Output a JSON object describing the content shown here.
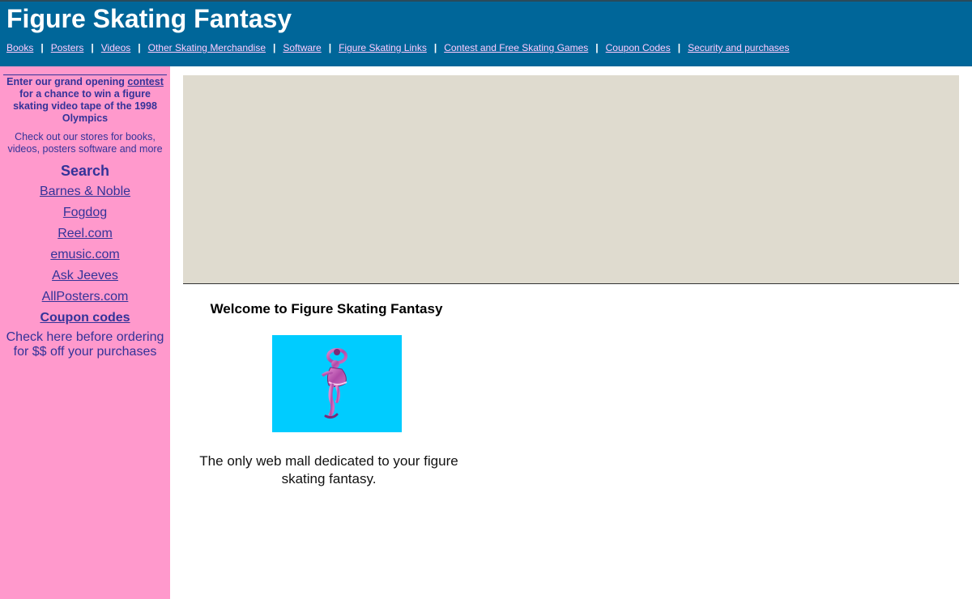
{
  "header": {
    "title": "Figure Skating Fantasy",
    "nav": [
      {
        "label": "Books"
      },
      {
        "label": "Posters"
      },
      {
        "label": "Videos"
      },
      {
        "label": "Other Skating Merchandise"
      },
      {
        "label": "Software"
      },
      {
        "label": "Figure Skating Links"
      },
      {
        "label": "Contest and Free Skating Games"
      },
      {
        "label": "Coupon Codes"
      },
      {
        "label": "Security and purchases"
      }
    ],
    "separator": "|"
  },
  "sidebar": {
    "promo_prefix": "Enter our grand opening ",
    "promo_link": "contest",
    "promo_suffix": " for a chance to win a figure skating video tape of the 1998 Olympics",
    "stores_note": "Check out our stores for books, videos, posters software and more",
    "search_heading": "Search",
    "search_links": [
      {
        "label": "Barnes & Noble"
      },
      {
        "label": "Fogdog"
      },
      {
        "label": "Reel.com"
      },
      {
        "label": "emusic.com"
      },
      {
        "label": "Ask Jeeves"
      },
      {
        "label": "AllPosters.com"
      }
    ],
    "coupon_link": "Coupon codes",
    "coupon_note": "Check here before ordering for $$ off your purchases"
  },
  "main": {
    "welcome": "Welcome to Figure Skating Fantasy",
    "tagline": "The only web mall dedicated to your figure skating fantasy."
  },
  "colors": {
    "header_bg": "#006699",
    "sidebar_bg": "#ff99cc",
    "banner_bg": "#dfdbcf",
    "image_bg": "#00ccff",
    "link_nav": "#ffccff",
    "sidebar_text": "#333399"
  }
}
